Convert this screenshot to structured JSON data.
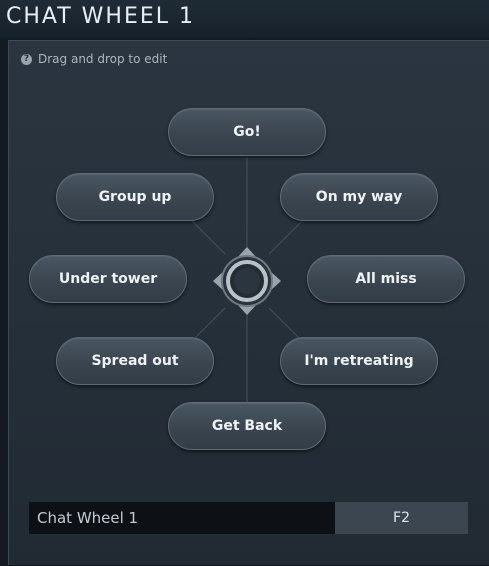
{
  "window": {
    "title": "CHAT WHEEL 1"
  },
  "hint": {
    "icon": "question-icon",
    "glyph": "?",
    "text": "Drag and drop to edit"
  },
  "wheel": {
    "center_icon": "compass-icon",
    "items": [
      {
        "id": "top",
        "label": "Go!"
      },
      {
        "id": "top-left",
        "label": "Group up"
      },
      {
        "id": "top-right",
        "label": "On my way"
      },
      {
        "id": "left",
        "label": "Under tower"
      },
      {
        "id": "right",
        "label": "All miss"
      },
      {
        "id": "bottom-left",
        "label": "Spread out"
      },
      {
        "id": "bottom-right",
        "label": "I'm retreating"
      },
      {
        "id": "bottom",
        "label": "Get Back"
      }
    ]
  },
  "footer": {
    "name_value": "Chat Wheel 1",
    "hotkey": "F2"
  },
  "colors": {
    "background": "#141a21",
    "panel": "#2b3540",
    "button": "#3a454f",
    "text": "#eef2f5"
  }
}
